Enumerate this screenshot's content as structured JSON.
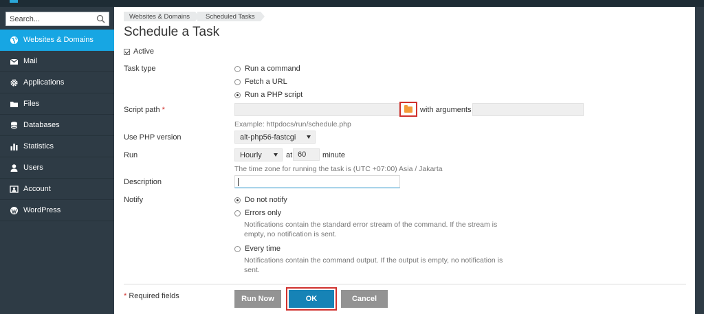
{
  "search": {
    "placeholder": "Search..."
  },
  "sidebar": {
    "items": [
      {
        "label": "Websites & Domains",
        "icon": "globe-icon"
      },
      {
        "label": "Mail",
        "icon": "envelope-icon"
      },
      {
        "label": "Applications",
        "icon": "gear-icon"
      },
      {
        "label": "Files",
        "icon": "folder-icon"
      },
      {
        "label": "Databases",
        "icon": "database-icon"
      },
      {
        "label": "Statistics",
        "icon": "bar-chart-icon"
      },
      {
        "label": "Users",
        "icon": "user-icon"
      },
      {
        "label": "Account",
        "icon": "account-card-icon"
      },
      {
        "label": "WordPress",
        "icon": "wordpress-icon"
      }
    ]
  },
  "breadcrumb": [
    "Websites & Domains",
    "Scheduled Tasks"
  ],
  "page": {
    "title": "Schedule a Task"
  },
  "form": {
    "active_label": "Active",
    "task_type": {
      "label": "Task type",
      "options": [
        "Run a command",
        "Fetch a URL",
        "Run a PHP script"
      ],
      "selected": "Run a PHP script"
    },
    "script_path": {
      "label": "Script path",
      "required_mark": "*",
      "value": "",
      "with_arguments": "with arguments",
      "hint": "Example: httpdocs/run/schedule.php"
    },
    "php_version": {
      "label": "Use PHP version",
      "value": "alt-php56-fastcgi"
    },
    "run": {
      "label": "Run",
      "frequency": "Hourly",
      "at": "at",
      "minute": "60",
      "minute_label": "minute",
      "hint": "The time zone for running the task is (UTC +07:00) Asia / Jakarta"
    },
    "description": {
      "label": "Description",
      "value": ""
    },
    "notify": {
      "label": "Notify",
      "options": [
        {
          "label": "Do not notify",
          "hint": ""
        },
        {
          "label": "Errors only",
          "hint": "Notifications contain the standard error stream of the command. If the stream is empty, no notification is sent."
        },
        {
          "label": "Every time",
          "hint": "Notifications contain the command output. If the output is empty, no notification is sent."
        }
      ],
      "selected": "Do not notify"
    }
  },
  "footer": {
    "required_mark": "*",
    "required_text": "Required fields",
    "run_now": "Run Now",
    "ok": "OK",
    "cancel": "Cancel"
  },
  "colors": {
    "sidebar_bg": "#2e3b45",
    "active_nav": "#17a6e3",
    "ok_button": "#1683b6",
    "highlight": "#d0312d",
    "folder": "#f39b3a"
  }
}
